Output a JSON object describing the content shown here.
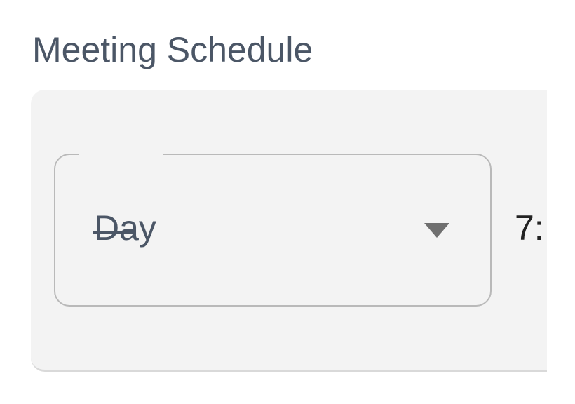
{
  "page": {
    "title": "Meeting Schedule"
  },
  "schedule": {
    "frequency_select": {
      "value": "Day",
      "icon": "triangle-down-icon"
    },
    "time_value": "7:"
  },
  "colors": {
    "title_text": "#4b5666",
    "card_background": "#f3f3f3",
    "outline": "#b9b9b9",
    "arrow": "#6f6f6f",
    "time_text": "#222222"
  }
}
